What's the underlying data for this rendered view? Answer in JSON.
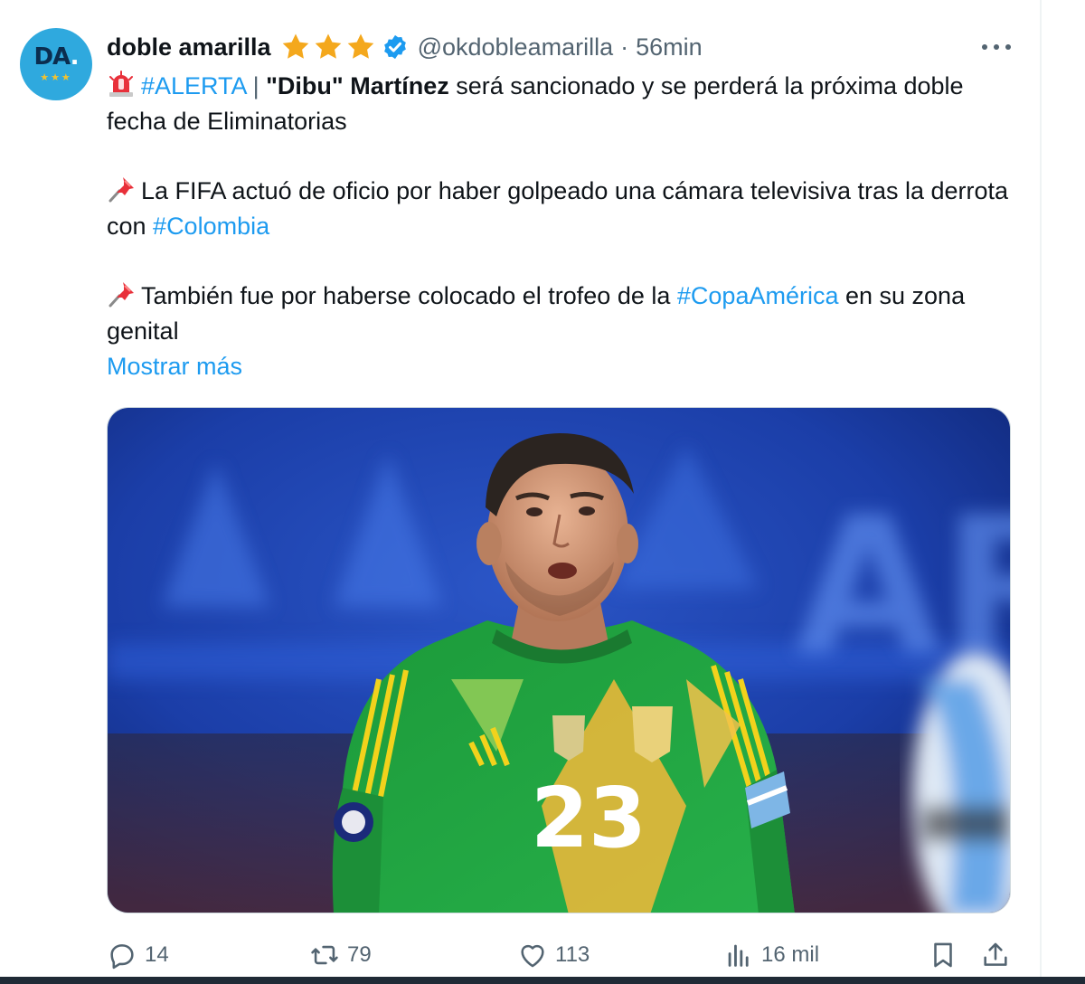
{
  "tweet": {
    "author": {
      "display_name": "doble amarilla",
      "avatar_text": "DA",
      "avatar_dot": ".",
      "avatar_stars": "★★★",
      "handle": "@okdobleamarilla",
      "separator": "·",
      "time": "56min"
    },
    "text": {
      "p1": {
        "hashtag": "#ALERTA",
        "divider": " | ",
        "bold_name_a": "\"Dibu\"",
        "bold_name_b": " Martínez",
        "rest": " será sancionado y se perderá la próxima doble fecha de Eliminatorias"
      },
      "p2": {
        "text": "La FIFA actuó de oficio por haber golpeado una cámara televisiva tras la derrota con ",
        "hashtag": "#Colombia"
      },
      "p3": {
        "text_a": "También fue por haberse colocado el trofeo de la ",
        "hashtag": "#CopaAmérica",
        "text_b": " en su zona genital"
      }
    },
    "show_more": "Mostrar más",
    "media": {
      "jersey_number": "23",
      "background_letters": "AR"
    },
    "actions": {
      "replies": "14",
      "retweets": "79",
      "likes": "113",
      "views": "16 mil"
    }
  },
  "colors": {
    "link": "#1d9bf0",
    "verified": "#1d9bf0",
    "gold_star": "#f4a81d",
    "muted": "#536471"
  },
  "icons": {
    "alert": "police-light-icon",
    "pin": "pushpin-icon",
    "reply": "reply-icon",
    "retweet": "retweet-icon",
    "like": "heart-icon",
    "views": "analytics-icon",
    "bookmark": "bookmark-icon",
    "share": "share-icon",
    "more": "more-icon"
  }
}
